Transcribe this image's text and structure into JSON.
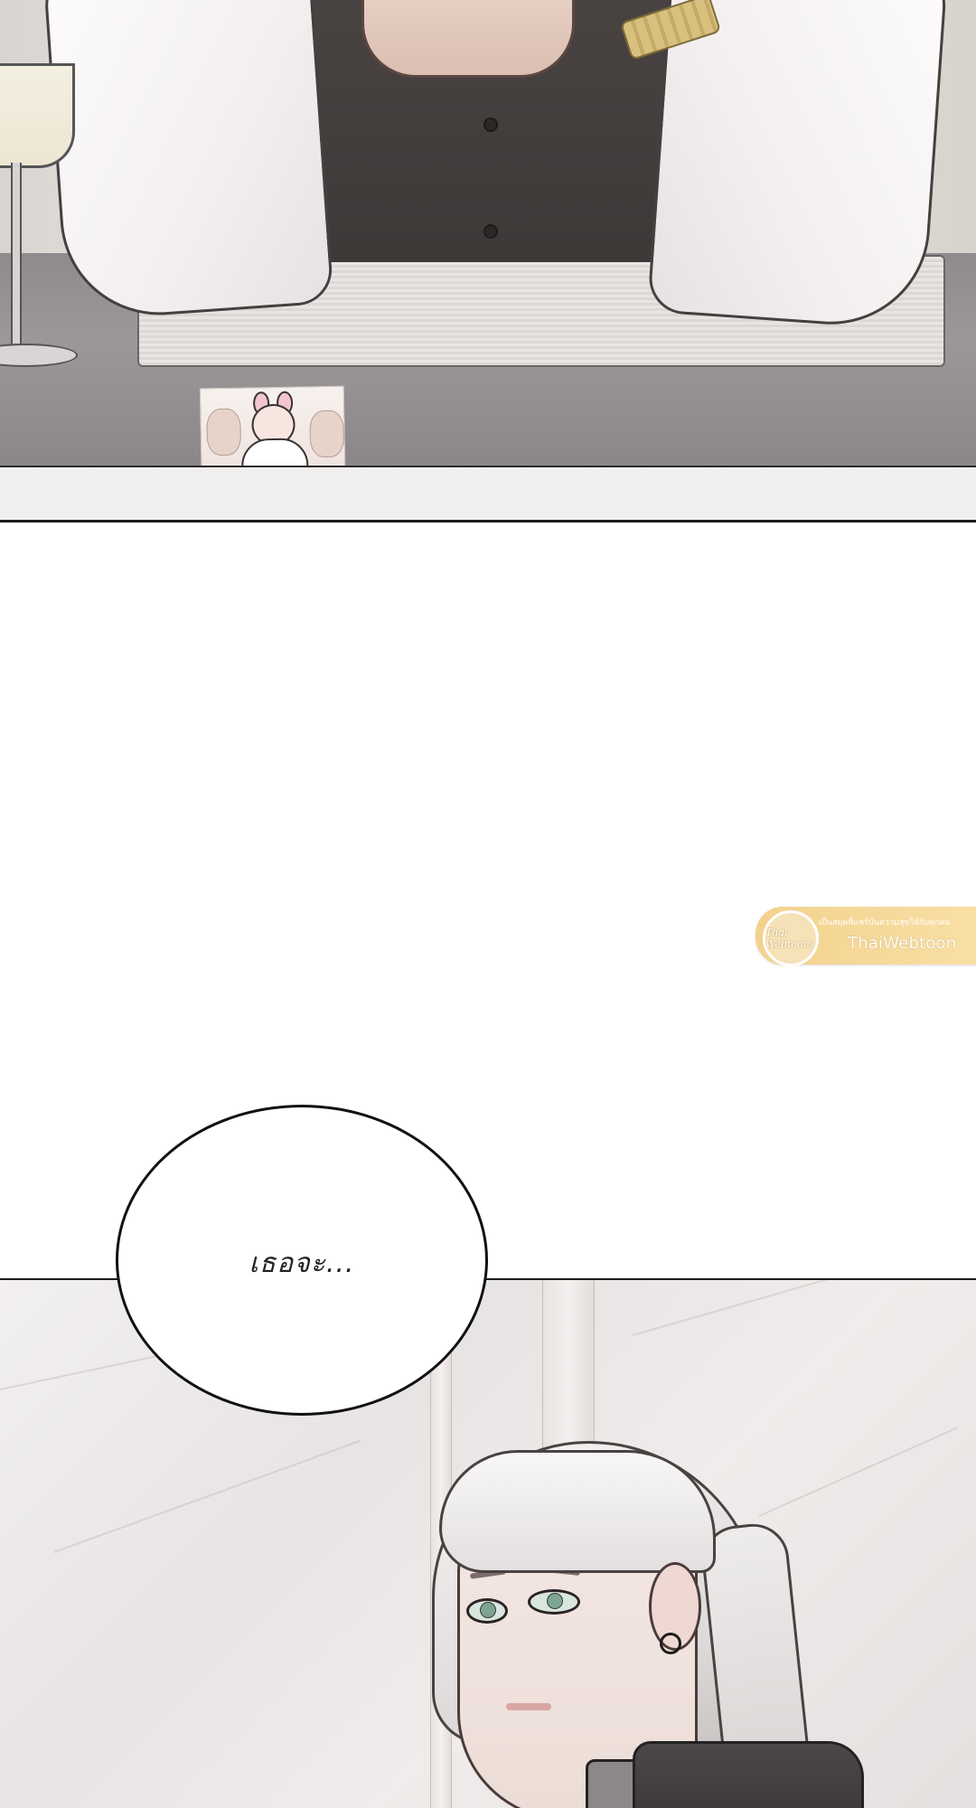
{
  "speech_bubble": {
    "text": "เธอจะ..."
  },
  "watermark": {
    "badge_text": "Thai Webtoons",
    "tagline": "เป็นสมุดที่แชร์ปันความสุขให้กับทุกคน",
    "brand": "ThaiWebtoon"
  },
  "colors": {
    "panel_border": "#1b1b1b",
    "watermark_gold": "#f3d28e",
    "background": "#ffffff"
  },
  "icons": {
    "watermark_logo": "thai-webtoons-logo"
  }
}
